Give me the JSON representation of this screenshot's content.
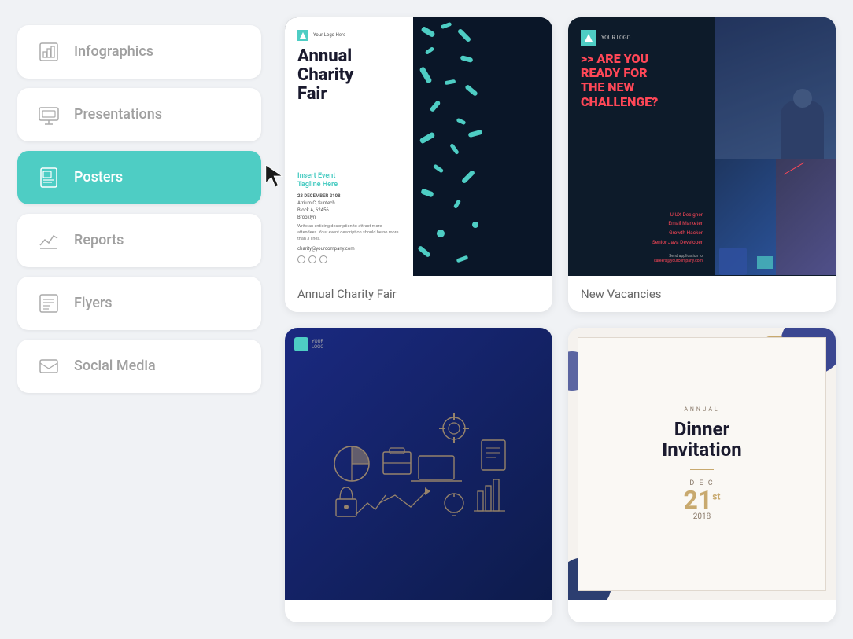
{
  "sidebar": {
    "items": [
      {
        "id": "infographics",
        "label": "Infographics",
        "active": false
      },
      {
        "id": "presentations",
        "label": "Presentations",
        "active": false
      },
      {
        "id": "posters",
        "label": "Posters",
        "active": true
      },
      {
        "id": "reports",
        "label": "Reports",
        "active": false
      },
      {
        "id": "flyers",
        "label": "Flyers",
        "active": false
      },
      {
        "id": "social-media",
        "label": "Social Media",
        "active": false
      }
    ]
  },
  "cards": [
    {
      "id": "charity-fair",
      "label": "Annual Charity Fair"
    },
    {
      "id": "new-vacancies",
      "label": "New Vacancies"
    },
    {
      "id": "tech-poster",
      "label": ""
    },
    {
      "id": "dinner-invitation",
      "label": ""
    }
  ]
}
